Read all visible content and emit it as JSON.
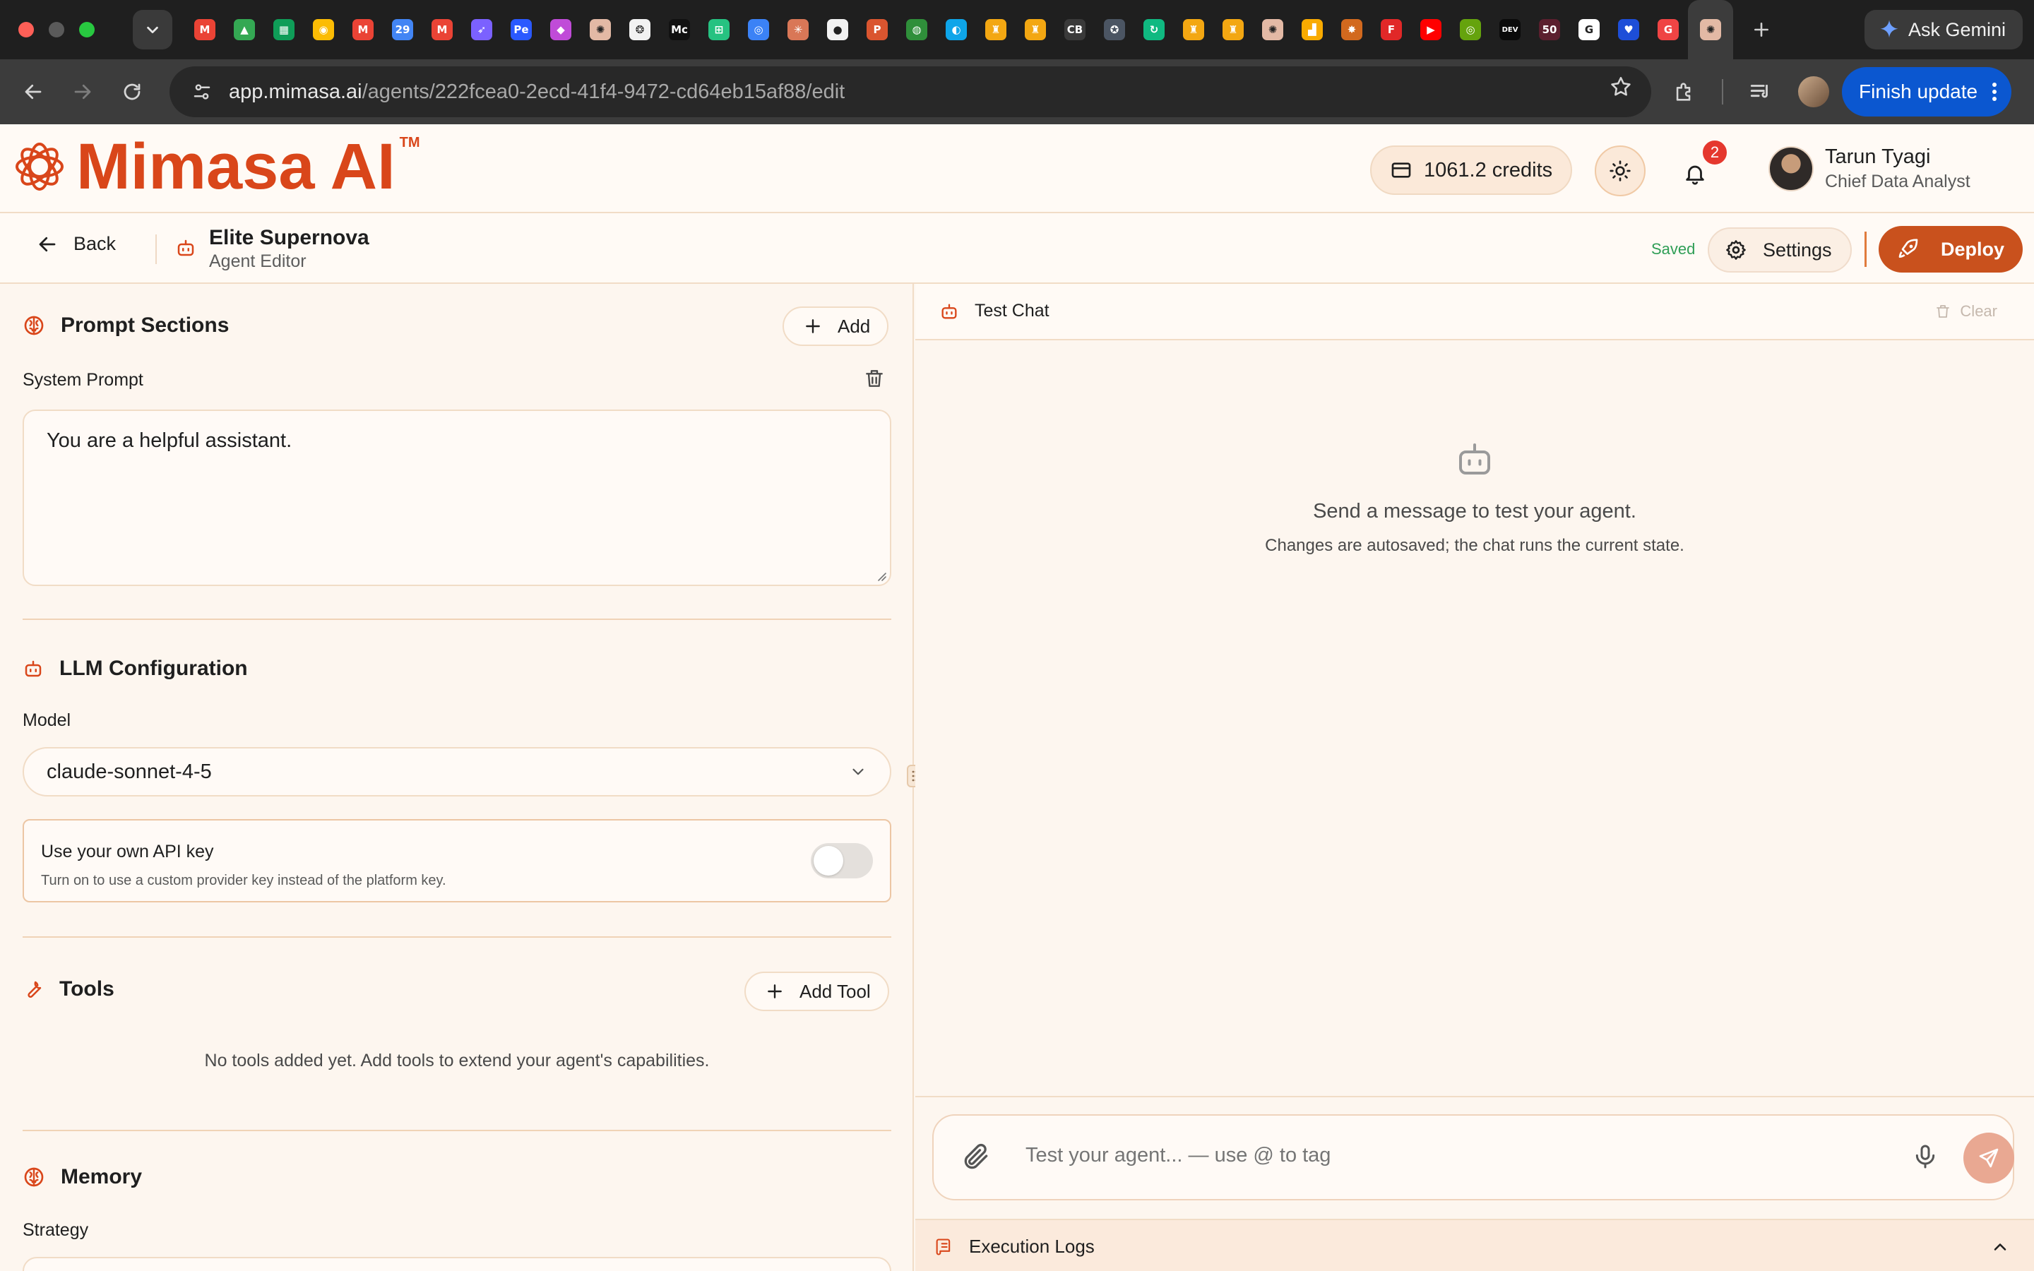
{
  "browser": {
    "tab_favicons": [
      {
        "icon": "gmail-icon",
        "color": "#ea4335",
        "glyph": "M"
      },
      {
        "icon": "drive-icon",
        "color": "#34a853",
        "glyph": "▲"
      },
      {
        "icon": "sheets-icon",
        "color": "#0f9d58",
        "glyph": "▦"
      },
      {
        "icon": "keep-icon",
        "color": "#fbbc04",
        "glyph": "◉"
      },
      {
        "icon": "gmail-icon",
        "color": "#ea4335",
        "glyph": "M"
      },
      {
        "icon": "calendar-icon",
        "color": "#4285f4",
        "glyph": "29"
      },
      {
        "icon": "gmail-icon",
        "color": "#ea4335",
        "glyph": "M"
      },
      {
        "icon": "comet-icon",
        "color": "#7b61ff",
        "glyph": "➶"
      },
      {
        "icon": "pe-icon",
        "color": "#2b59ff",
        "glyph": "Pe"
      },
      {
        "icon": "shape-icon",
        "color": "#c04bd8",
        "glyph": "◆"
      },
      {
        "icon": "mimasa-icon",
        "color": "#e3b9a5",
        "glyph": "✺"
      },
      {
        "icon": "openai-icon",
        "color": "#f2f2f2",
        "glyph": "❂"
      },
      {
        "icon": "medium-icon",
        "color": "#111111",
        "glyph": "Mc"
      },
      {
        "icon": "keycdn-icon",
        "color": "#26c281",
        "glyph": "⊞"
      },
      {
        "icon": "wave-icon",
        "color": "#3b82f6",
        "glyph": "◎"
      },
      {
        "icon": "claude-icon",
        "color": "#d97757",
        "glyph": "✳"
      },
      {
        "icon": "github-icon",
        "color": "#f2f2f2",
        "glyph": "●"
      },
      {
        "icon": "producthunt-icon",
        "color": "#da552f",
        "glyph": "P"
      },
      {
        "icon": "circle-green-icon",
        "color": "#2f8f3a",
        "glyph": "◍"
      },
      {
        "icon": "globe-icon",
        "color": "#0ea5e9",
        "glyph": "◐"
      },
      {
        "icon": "emblem-icon",
        "color": "#f3a712",
        "glyph": "♜"
      },
      {
        "icon": "emblem-icon",
        "color": "#f3a712",
        "glyph": "♜"
      },
      {
        "icon": "crunchbase-icon",
        "color": "#3a3a3a",
        "glyph": "CB"
      },
      {
        "icon": "compass-icon",
        "color": "#4b5563",
        "glyph": "✪"
      },
      {
        "icon": "loop-icon",
        "color": "#10b981",
        "glyph": "↻"
      },
      {
        "icon": "emblem-icon",
        "color": "#f3a712",
        "glyph": "♜"
      },
      {
        "icon": "emblem-icon",
        "color": "#f3a712",
        "glyph": "♜"
      },
      {
        "icon": "mimasa-icon",
        "color": "#e3b9a5",
        "glyph": "✺"
      },
      {
        "icon": "analytics-icon",
        "color": "#f9ab00",
        "glyph": "▟"
      },
      {
        "icon": "badge-icon",
        "color": "#d2691e",
        "glyph": "✸"
      },
      {
        "icon": "flipboard-icon",
        "color": "#e12828",
        "glyph": "F"
      },
      {
        "icon": "youtube-icon",
        "color": "#ff0000",
        "glyph": "▶"
      },
      {
        "icon": "circle-lime-icon",
        "color": "#65a30d",
        "glyph": "◎"
      },
      {
        "icon": "dev-icon",
        "color": "#0a0a0a",
        "glyph": "DEV"
      },
      {
        "icon": "fifty-icon",
        "color": "#5b1f2e",
        "glyph": "50"
      },
      {
        "icon": "google-icon",
        "color": "#ffffff",
        "glyph": "G"
      },
      {
        "icon": "heart-icon",
        "color": "#1d4ed8",
        "glyph": "♥"
      },
      {
        "icon": "grammarly-icon",
        "color": "#ef4444",
        "glyph": "G"
      },
      {
        "icon": "mimasa-icon",
        "color": "#e3b9a5",
        "glyph": "✺"
      }
    ],
    "ask_gemini": "Ask Gemini",
    "url_host": "app.mimasa.ai",
    "url_path": "/agents/222fcea0-2ecd-41f4-9472-cd64eb15af88/edit",
    "finish_update": "Finish update"
  },
  "header": {
    "brand": "Mimasa AI",
    "brand_tm": "TM",
    "credits": "1061.2 credits",
    "notification_count": "2",
    "user_name": "Tarun Tyagi",
    "user_role": "Chief Data Analyst"
  },
  "editor": {
    "back_label": "Back",
    "agent_name": "Elite Supernova",
    "agent_subtitle": "Agent Editor",
    "saved_label": "Saved",
    "settings_label": "Settings",
    "deploy_label": "Deploy"
  },
  "prompt": {
    "title": "Prompt Sections",
    "add_label": "Add",
    "system_label": "System Prompt",
    "system_value": "You are a helpful assistant."
  },
  "llm": {
    "title": "LLM Configuration",
    "model_label": "Model",
    "model_value": "claude-sonnet-4-5",
    "own_key_title": "Use your own API key",
    "own_key_desc": "Turn on to use a custom provider key instead of the platform key.",
    "own_key_enabled": false
  },
  "tools": {
    "title": "Tools",
    "add_label": "Add Tool",
    "empty": "No tools added yet. Add tools to extend your agent's capabilities."
  },
  "memory": {
    "title": "Memory",
    "strategy_label": "Strategy"
  },
  "chat": {
    "title": "Test Chat",
    "clear_label": "Clear",
    "empty_title": "Send a message to test your agent.",
    "empty_sub": "Changes are autosaved; the chat runs the current state.",
    "input_placeholder": "Test your agent... — use @ to tag",
    "logs_label": "Execution Logs"
  },
  "colors": {
    "brand": "#d9461a",
    "deploy": "#c9511d",
    "saved": "#2f9e56",
    "badge": "#e5382e",
    "finish_update": "#0b57d0"
  }
}
